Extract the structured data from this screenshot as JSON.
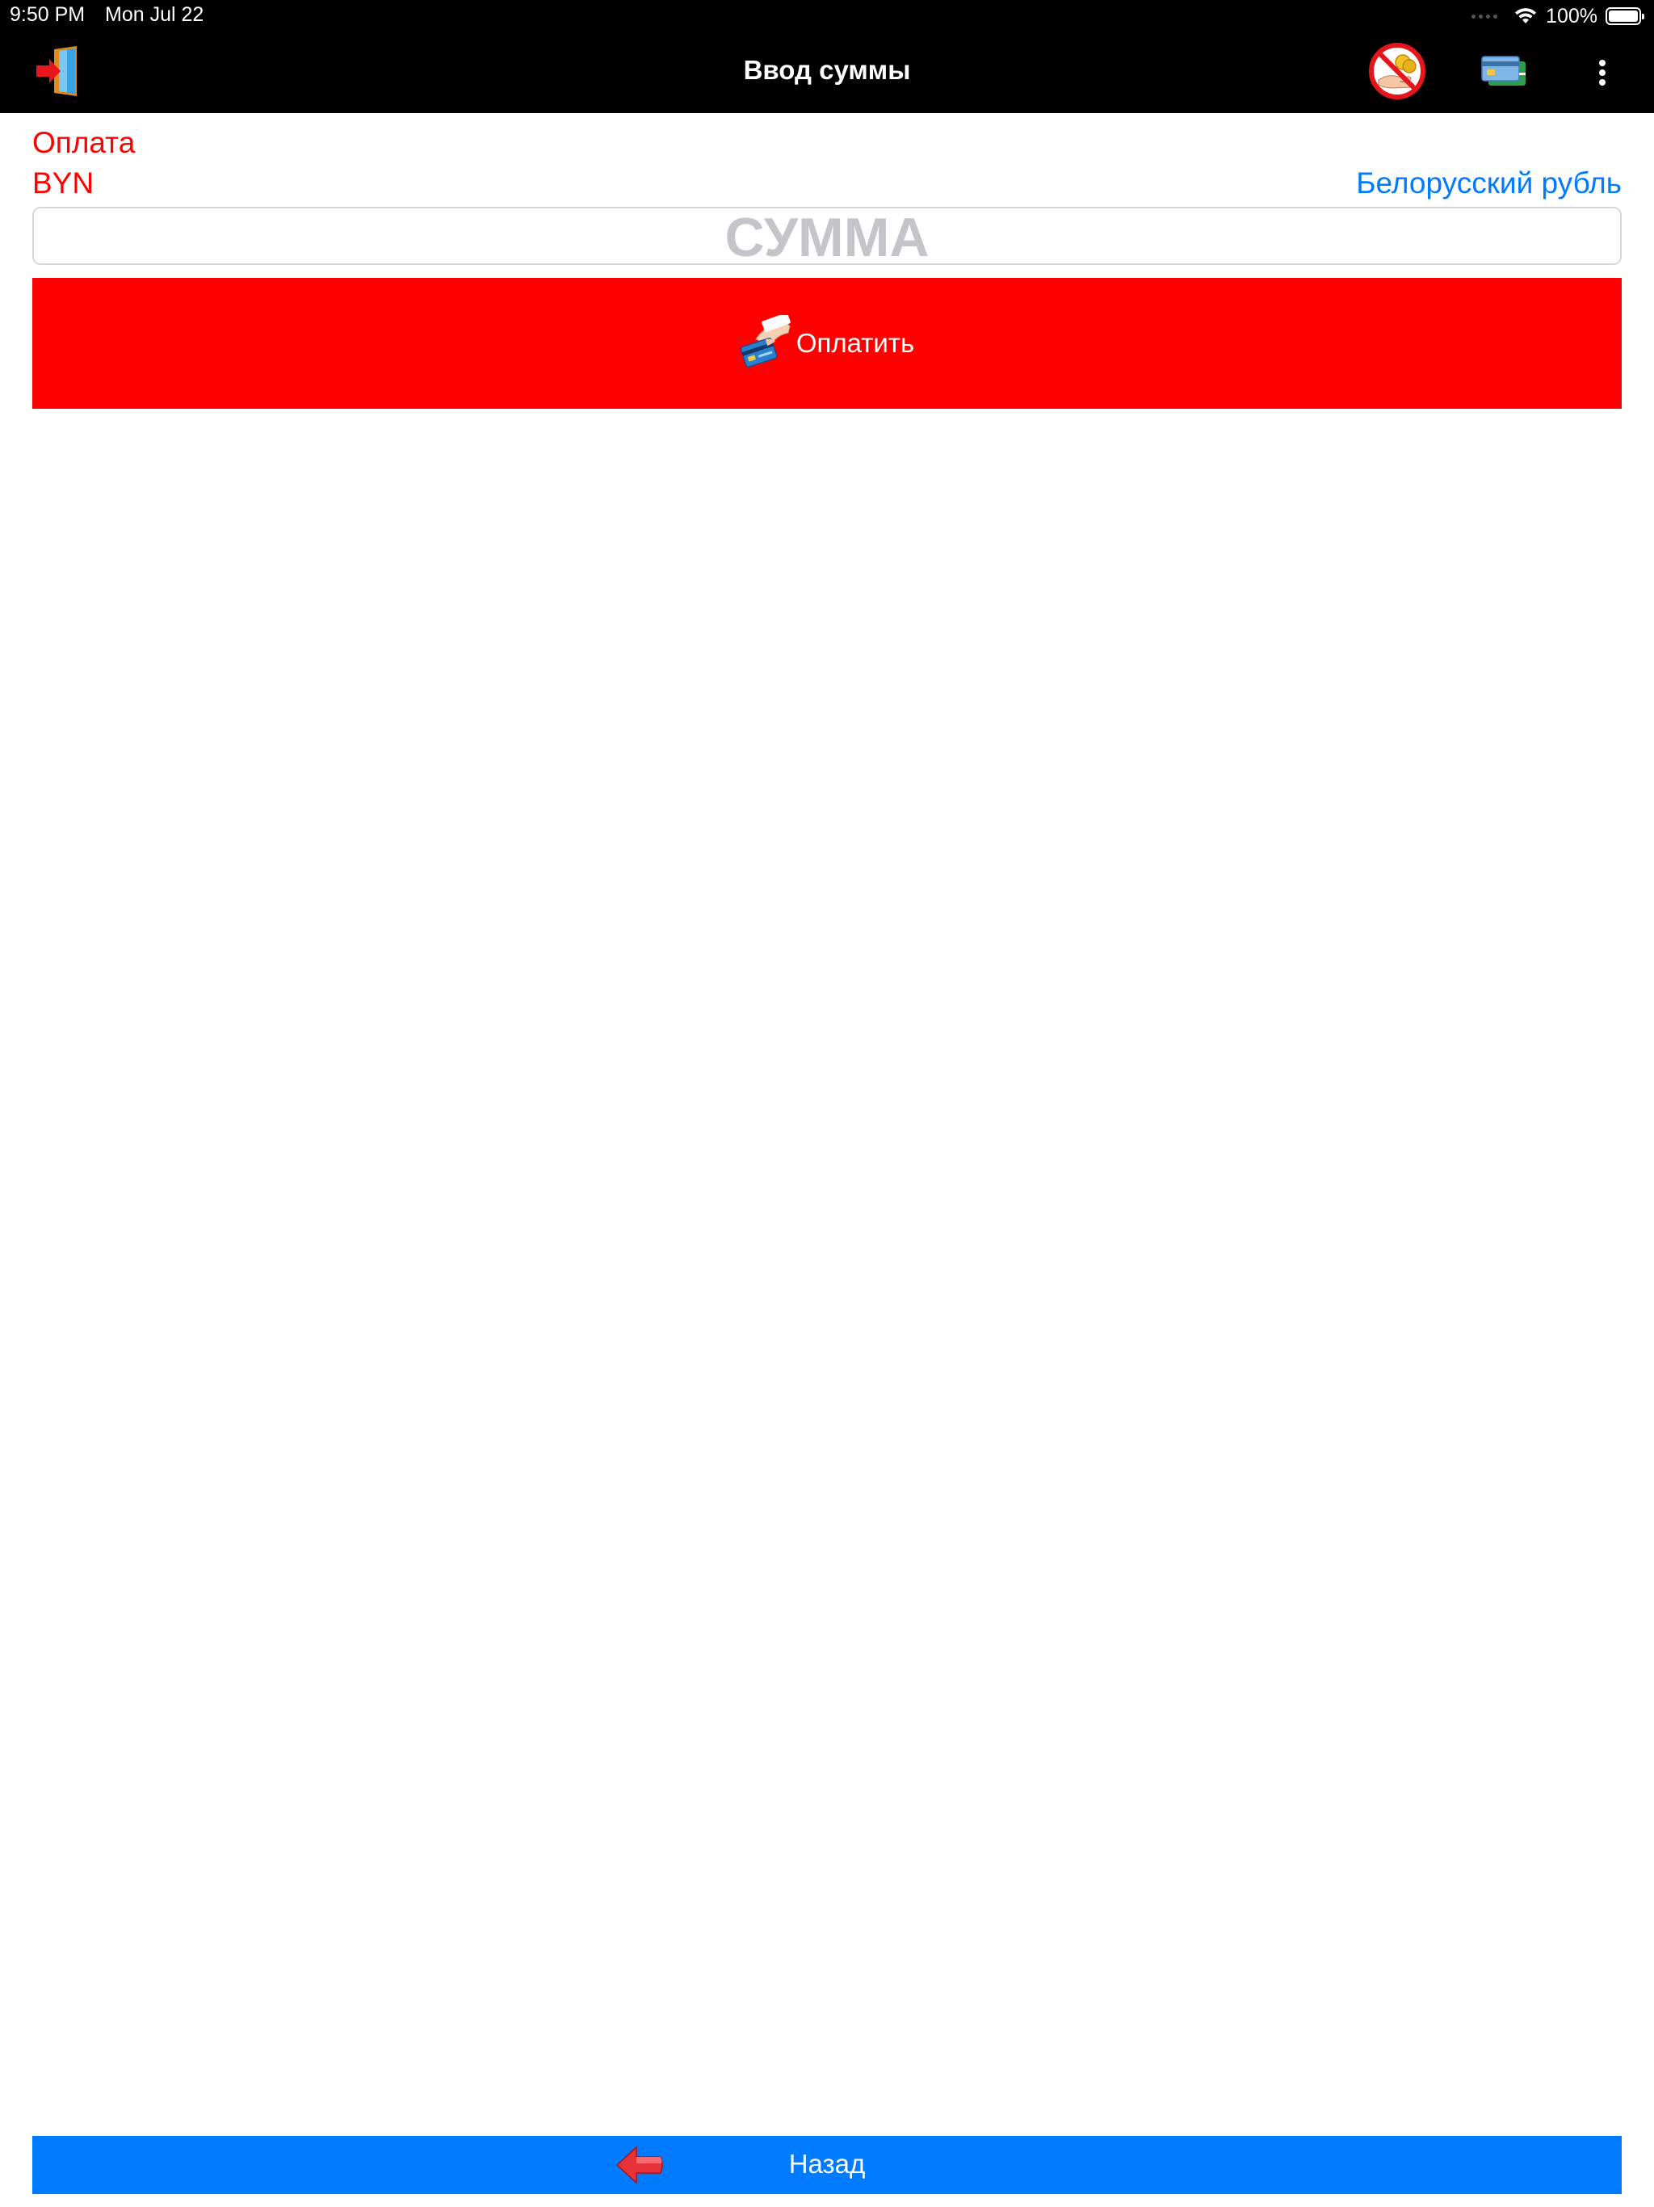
{
  "status_bar": {
    "time": "9:50 PM",
    "date": "Mon Jul 22",
    "battery": "100%"
  },
  "nav": {
    "title": "Ввод суммы",
    "exit_icon": "exit-door-icon",
    "no_cash_icon": "no-cash-icon",
    "card_icon": "card-payment-icon",
    "menu_icon": "more-vertical-icon"
  },
  "payment": {
    "label": "Оплата",
    "currency_code": "BYN",
    "currency_name": "Белорусский рубль"
  },
  "amount": {
    "placeholder": "СУММА",
    "value": ""
  },
  "pay_button": {
    "label": "Оплатить",
    "icon": "card-in-hand-icon",
    "color": "#ff0000"
  },
  "back_button": {
    "label": "Назад",
    "icon": "back-arrow-icon",
    "color": "#007aff"
  },
  "colors": {
    "accent_red": "#ff0000",
    "accent_blue": "#007aff",
    "navbar": "#000000"
  }
}
